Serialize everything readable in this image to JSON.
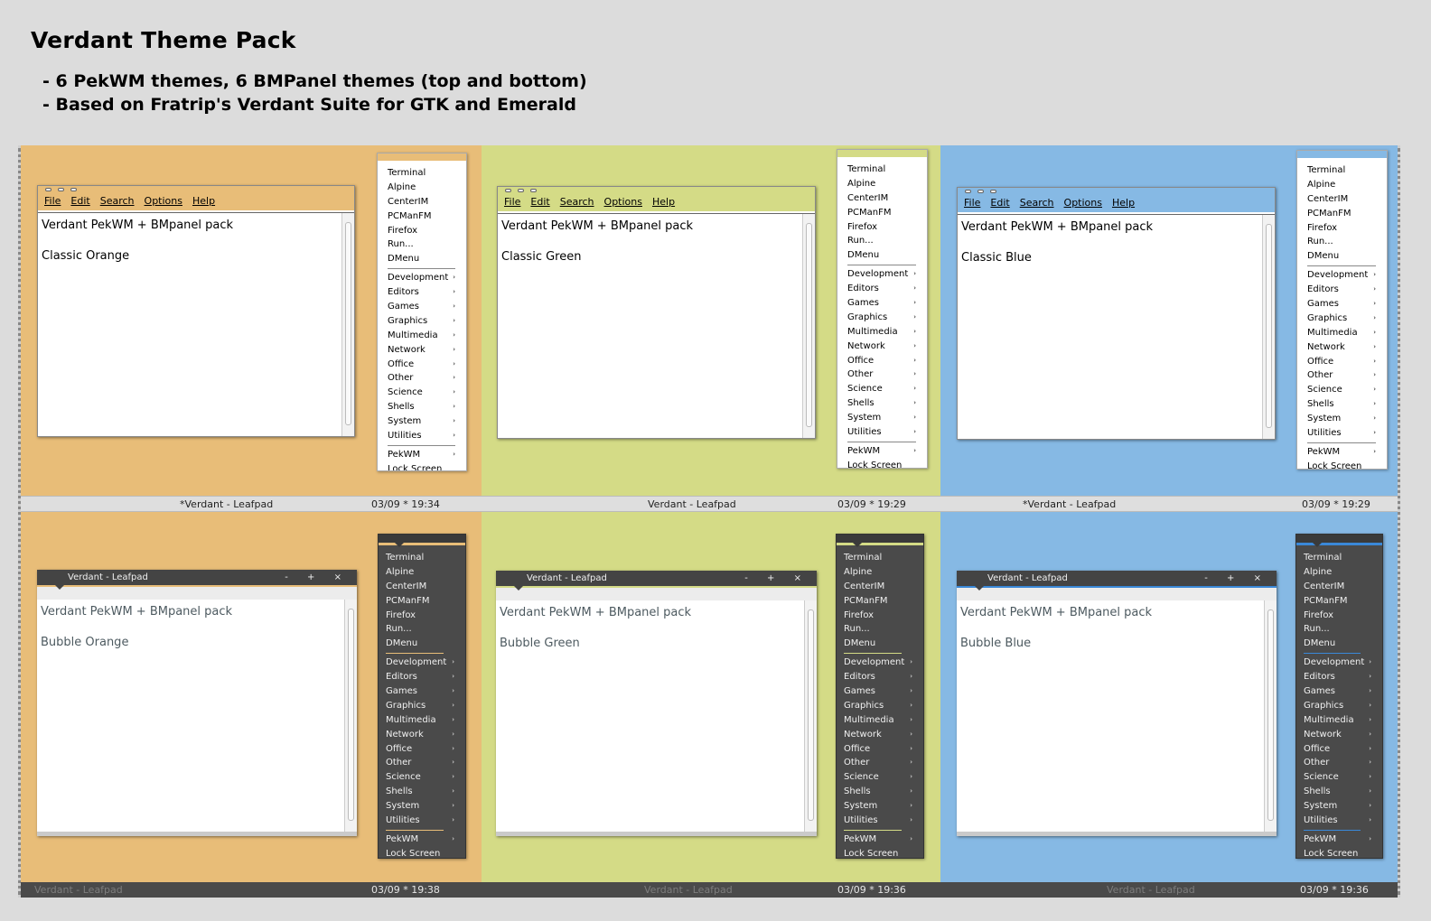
{
  "header": {
    "title": "Verdant Theme Pack",
    "bullets": [
      "- 6 PekWM themes, 6 BMPanel themes (top and bottom)",
      "- Based on Fratrip's Verdant Suite for GTK and Emerald"
    ]
  },
  "colors": {
    "orange": "#e8bd78",
    "green": "#d4db86",
    "blue": "#86b9e4",
    "dark": "#444444"
  },
  "menubar_items": [
    "File",
    "Edit",
    "Search",
    "Options",
    "Help"
  ],
  "menu": {
    "apps": [
      "Terminal",
      "Alpine",
      "CenterIM",
      "PCManFM",
      "Firefox",
      "Run...",
      "DMenu"
    ],
    "categories": [
      "Development",
      "Editors",
      "Games",
      "Graphics",
      "Multimedia",
      "Network",
      "Office",
      "Other",
      "Science",
      "Shells",
      "System",
      "Utilities"
    ],
    "footer": [
      "PekWM",
      "Lock Screen"
    ],
    "submenu_arrow": "›"
  },
  "classic_titlebar_buttons_icon": "three-dot-buttons-icon",
  "bubble_titlebar_controls": "- + ×",
  "editor_line1": "Verdant PekWM + BMpanel pack",
  "themes": [
    {
      "variant": "Classic Orange",
      "accent": "#e8bd78"
    },
    {
      "variant": "Classic Green",
      "accent": "#d4db86"
    },
    {
      "variant": "Classic Blue",
      "accent": "#86b9e4"
    },
    {
      "variant": "Bubble Orange",
      "accent": "#e8bd78"
    },
    {
      "variant": "Bubble Green",
      "accent": "#d4db86"
    },
    {
      "variant": "Bubble Blue",
      "accent": "#86b9e4"
    }
  ],
  "bubble_window_title": "Verdant - Leafpad",
  "top_panel": [
    {
      "task": "*Verdant - Leafpad",
      "clock": "03/09 * 19:34"
    },
    {
      "task": "Verdant - Leafpad",
      "clock": "03/09 * 19:29"
    },
    {
      "task": "*Verdant - Leafpad",
      "clock": "03/09 * 19:29"
    }
  ],
  "bottom_panel": [
    {
      "task": "Verdant - Leafpad",
      "clock": "03/09 * 19:38"
    },
    {
      "task": "Verdant - Leafpad",
      "clock": "03/09 * 19:36"
    },
    {
      "task": "Verdant - Leafpad",
      "clock": "03/09 * 19:36"
    }
  ]
}
